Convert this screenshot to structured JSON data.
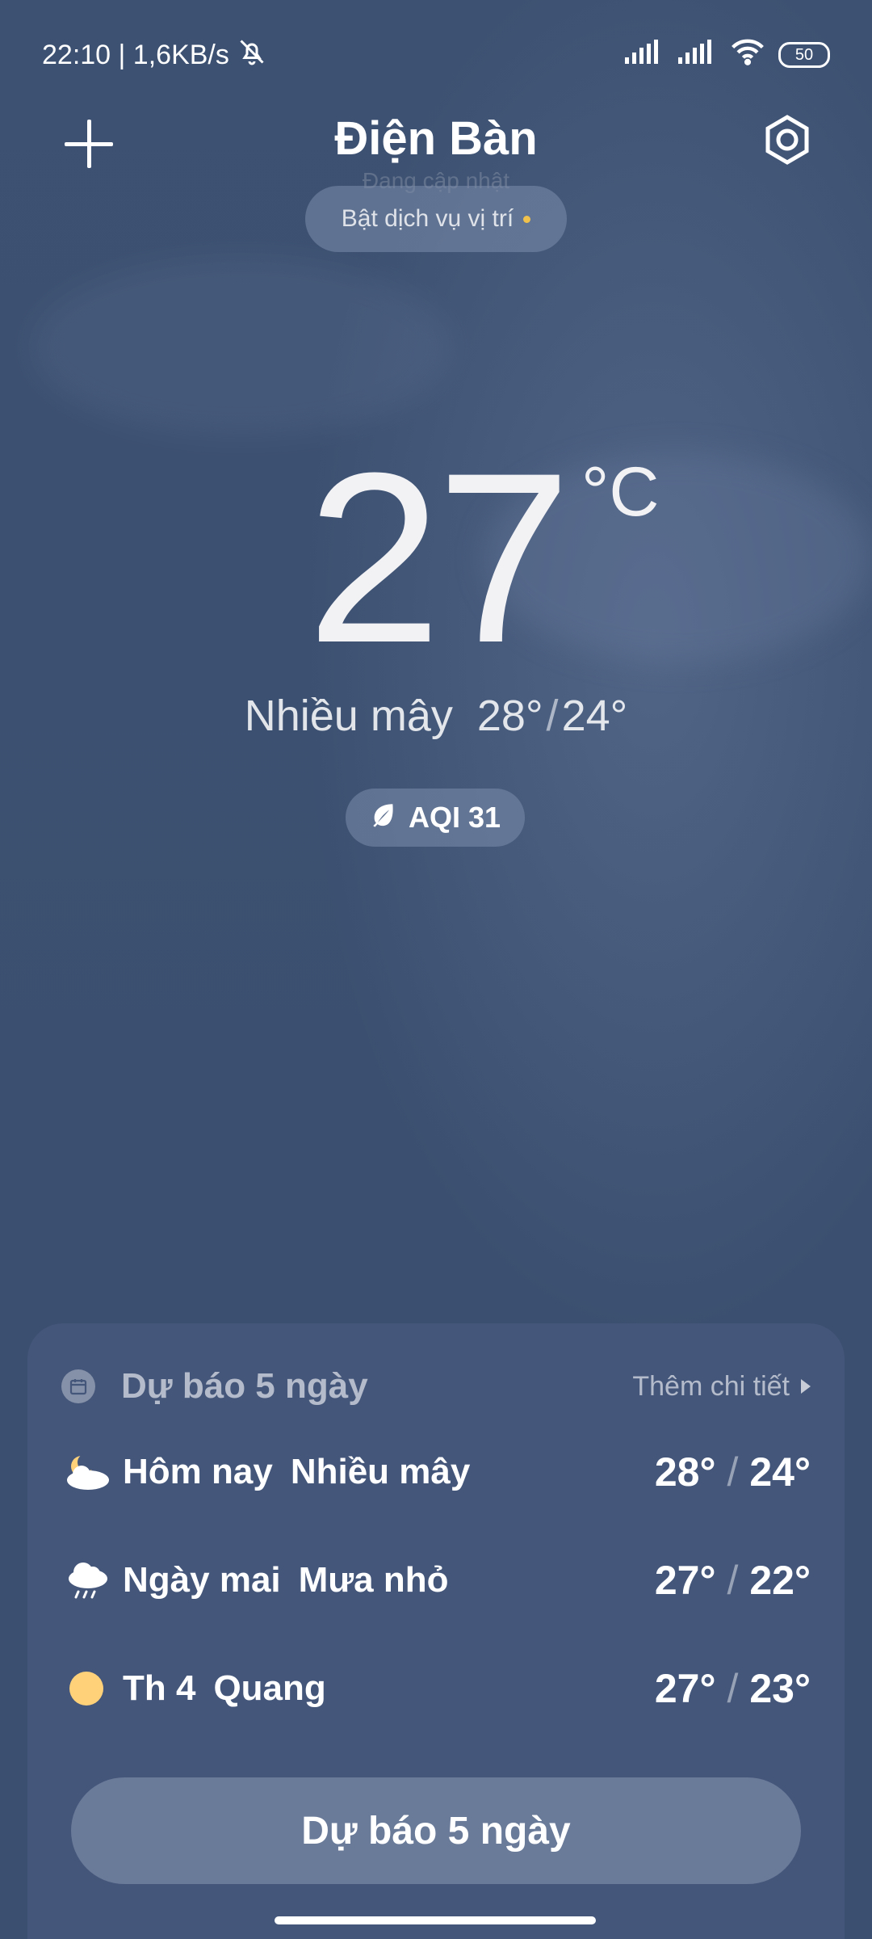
{
  "status_bar": {
    "time_speed": "22:10 | 1,6KB/s",
    "battery": "50",
    "icons": [
      "bell-off-icon",
      "signal-icon",
      "signal-icon",
      "wifi-icon",
      "battery-icon"
    ]
  },
  "header": {
    "city": "Điện Bàn",
    "updating_text": "Đang cập nhật",
    "location_service": "Bật dịch vụ vị trí",
    "add_icon": "plus-icon",
    "settings_icon": "gear-icon"
  },
  "current": {
    "temperature": "27",
    "unit": "°C",
    "condition": "Nhiều mây",
    "high": "28°",
    "low": "24°",
    "aqi": "AQI 31"
  },
  "forecast": {
    "title": "Dự báo 5 ngày",
    "more": "Thêm chi tiết",
    "days": [
      {
        "day": "Hôm nay",
        "desc": "Nhiều mây",
        "high": "28°",
        "low": "24°",
        "icon": "partly-cloudy-night-icon"
      },
      {
        "day": "Ngày mai",
        "desc": "Mưa nhỏ",
        "high": "27°",
        "low": "22°",
        "icon": "light-rain-icon"
      },
      {
        "day": "Th 4",
        "desc": "Quang",
        "high": "27°",
        "low": "23°",
        "icon": "sunny-icon"
      }
    ],
    "button": "Dự báo 5 ngày"
  },
  "colors": {
    "background": "#3b4f70",
    "card": "#44567a",
    "button": "#6a7a99",
    "accent_dot": "#f0c24b",
    "sun": "#ffd27a"
  }
}
